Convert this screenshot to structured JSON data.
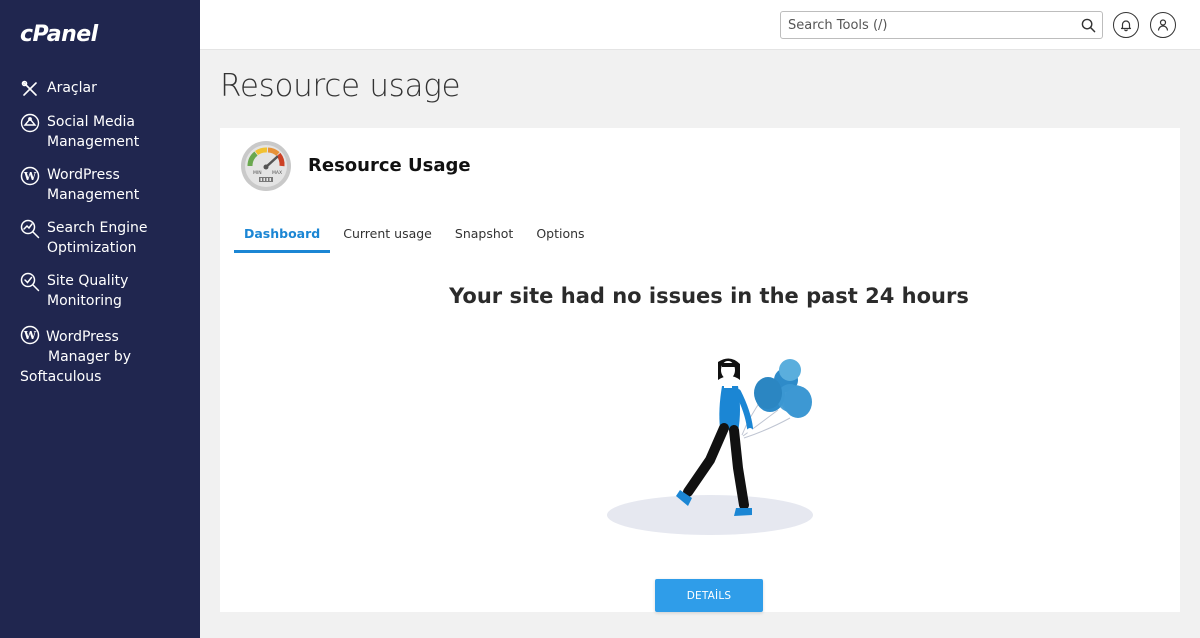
{
  "brand": {
    "logo": "cPanel"
  },
  "sidebar": {
    "items": [
      {
        "label": "Araçlar",
        "icon": "tools-icon"
      },
      {
        "label": "Social Media Management",
        "line1": "Social Media",
        "line2": "Management",
        "icon": "social-media-icon"
      },
      {
        "label": "WordPress Management",
        "line1": "WordPress",
        "line2": "Management",
        "icon": "wordpress-icon"
      },
      {
        "label": "Search Engine Optimization",
        "line1": "Search Engine",
        "line2": "Optimization",
        "icon": "seo-icon"
      },
      {
        "label": "Site Quality Monitoring",
        "line1": "Site Quality",
        "line2": "Monitoring",
        "icon": "site-quality-icon"
      },
      {
        "label": "WordPress Manager by Softaculous",
        "line1": "WordPress",
        "line2": "Manager by",
        "line3": "Softaculous",
        "icon": "wordpress-icon"
      }
    ]
  },
  "topbar": {
    "search_placeholder": "Search Tools (/)",
    "notifications_icon": "bell-icon",
    "user_icon": "user-icon"
  },
  "page": {
    "title": "Resource usage",
    "app_title": "Resource Usage",
    "tabs": [
      {
        "label": "Dashboard",
        "active": true
      },
      {
        "label": "Current usage",
        "active": false
      },
      {
        "label": "Snapshot",
        "active": false
      },
      {
        "label": "Options",
        "active": false
      }
    ],
    "message": "Your site had no issues in the past 24 hours",
    "details_button": "DETAİLS",
    "gauge_min_label": "MIN",
    "gauge_max_label": "MAX"
  },
  "colors": {
    "sidebar_bg": "#20264f",
    "accent": "#1b86d4",
    "button": "#2f9de9",
    "balloon": "#2e8bc9"
  }
}
